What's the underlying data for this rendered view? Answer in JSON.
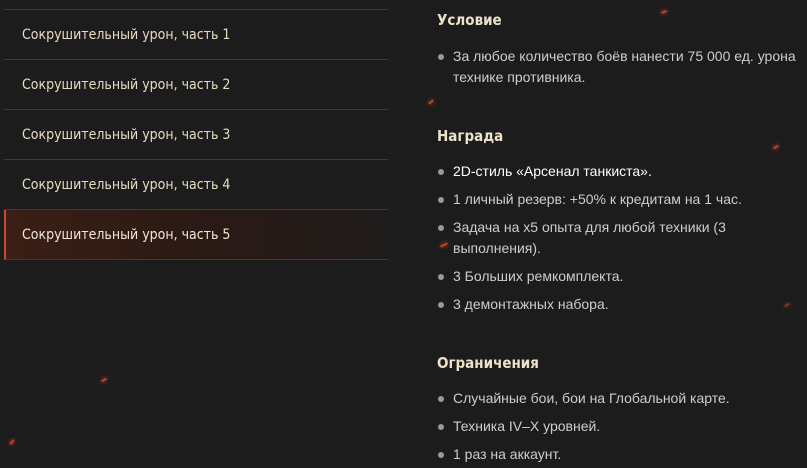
{
  "missions": [
    {
      "label": "Сокрушительный урон, часть 1",
      "active": false
    },
    {
      "label": "Сокрушительный урон, часть 2",
      "active": false
    },
    {
      "label": "Сокрушительный урон, часть 3",
      "active": false
    },
    {
      "label": "Сокрушительный урон, часть 4",
      "active": false
    },
    {
      "label": "Сокрушительный урон, часть 5",
      "active": true
    }
  ],
  "condition": {
    "title": "Условие",
    "items": [
      "За любое количество боёв нанести 75 000 ед. урона технике противника."
    ]
  },
  "reward": {
    "title": "Награда",
    "items": [
      "2D-стиль «Арсенал танкиста».",
      "1 личный резерв: +50% к кредитам на 1 час.",
      "Задача на x5 опыта для любой техники (3 выполнения).",
      "3 Больших ремкомплекта.",
      "3 демонтажных набора."
    ]
  },
  "restrictions": {
    "title": "Ограничения",
    "items": [
      "Случайные бои, бои на Глобальной карте.",
      "Техника IV–X уровней.",
      "1 раз на аккаунт."
    ]
  },
  "colors": {
    "background": "#1c1c1d",
    "accent": "#c8482a",
    "title": "#ece2c8",
    "text": "#cdcdcd"
  }
}
